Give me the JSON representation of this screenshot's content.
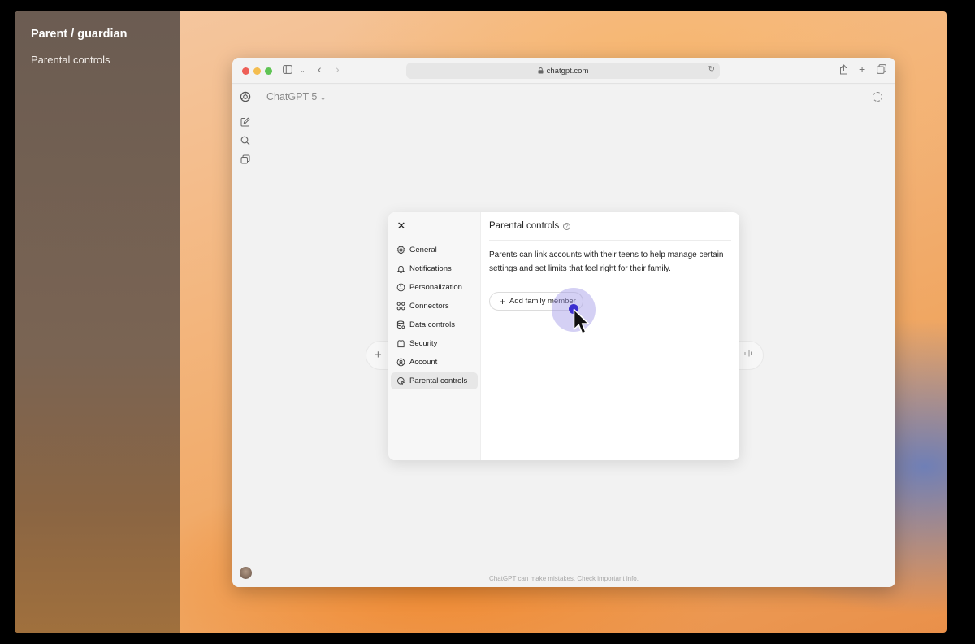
{
  "overlay": {
    "title": "Parent / guardian",
    "subtitle": "Parental controls"
  },
  "browser": {
    "url": "chatgpt.com"
  },
  "app": {
    "model_label": "ChatGPT 5",
    "footer": "ChatGPT can make mistakes. Check important info."
  },
  "settings": {
    "nav": [
      {
        "label": "General",
        "icon": "gear-icon"
      },
      {
        "label": "Notifications",
        "icon": "bell-icon"
      },
      {
        "label": "Personalization",
        "icon": "personalization-icon"
      },
      {
        "label": "Connectors",
        "icon": "connectors-icon"
      },
      {
        "label": "Data controls",
        "icon": "database-icon"
      },
      {
        "label": "Security",
        "icon": "security-icon"
      },
      {
        "label": "Account",
        "icon": "account-icon"
      },
      {
        "label": "Parental controls",
        "icon": "parental-controls-icon"
      }
    ],
    "active": "Parental controls",
    "header": "Parental controls",
    "description": "Parents can link accounts with their teens to help manage certain settings and set limits that feel right for their family.",
    "add_button": "Add family member"
  },
  "colors": {
    "click_highlight": "#3c2fd0",
    "traffic_red": "#ee5f57",
    "traffic_yellow": "#f4bd4f",
    "traffic_green": "#5fc454"
  }
}
